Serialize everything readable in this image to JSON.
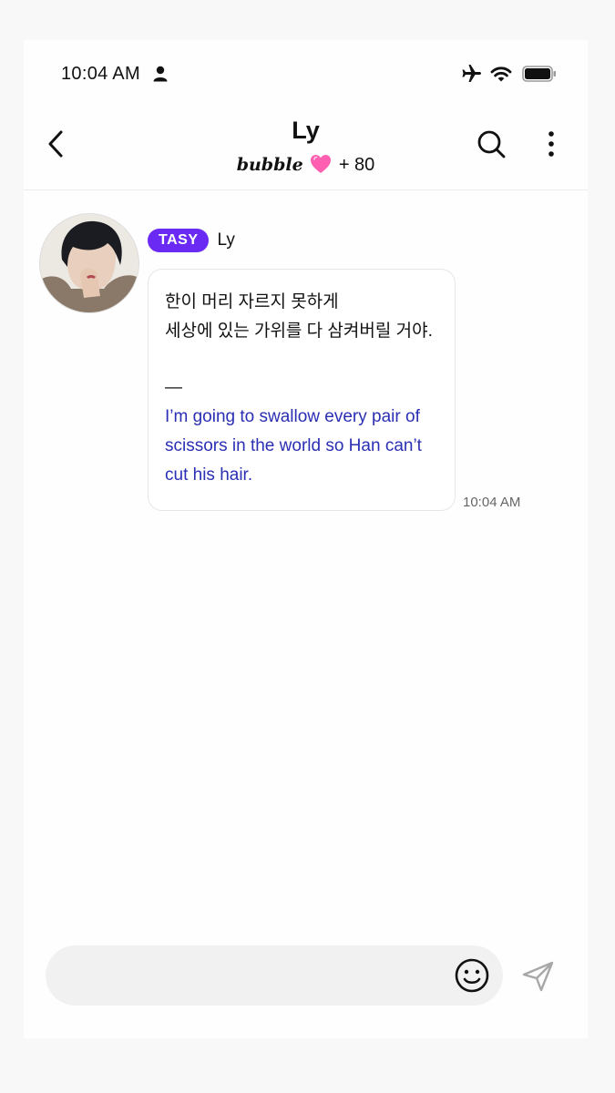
{
  "status_bar": {
    "time": "10:04 AM"
  },
  "header": {
    "title": "Ly",
    "brand": "bubble",
    "count": "+ 80"
  },
  "message": {
    "tag": "TASY",
    "sender": "Ly",
    "korean_lines": [
      "한이 머리 자르지 못하게",
      "세상에 있는 가위를 다 삼켜버릴 거야."
    ],
    "separator": "—",
    "translation_lines": [
      "I’m going to swallow every pair of",
      "scissors in the world so Han can’t",
      "cut his hair."
    ],
    "time": "10:04 AM"
  },
  "input": {
    "placeholder": ""
  },
  "colors": {
    "accent": "#6a2af4",
    "translation": "#2a2fb4",
    "heart": "#ff5fb0"
  }
}
